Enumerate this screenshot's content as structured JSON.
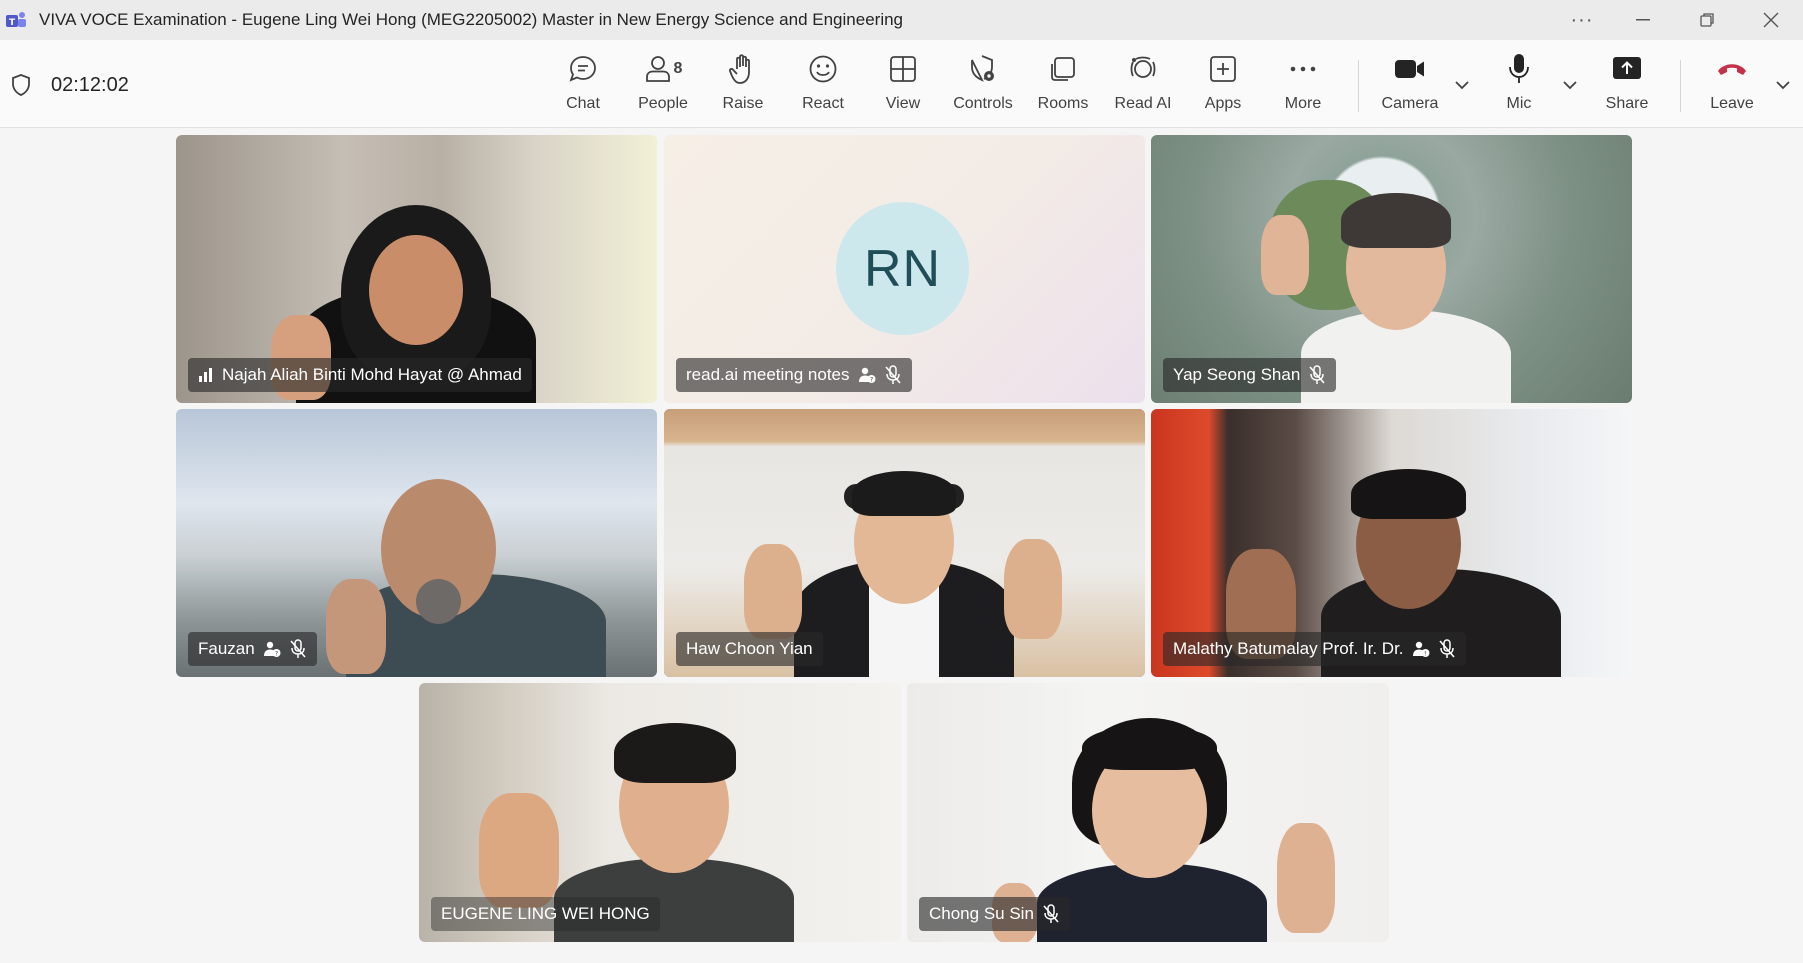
{
  "window": {
    "title": "VIVA VOCE Examination - Eugene Ling Wei Hong (MEG2205002) Master in New Energy Science and Engineering"
  },
  "meeting": {
    "timer": "02:12:02"
  },
  "toolbar": {
    "chat": "Chat",
    "people": "People",
    "people_count": "8",
    "raise": "Raise",
    "react": "React",
    "view": "View",
    "controls": "Controls",
    "rooms": "Rooms",
    "read_ai": "Read AI",
    "apps": "Apps",
    "more": "More",
    "camera": "Camera",
    "mic": "Mic",
    "share": "Share",
    "leave": "Leave"
  },
  "participants": [
    {
      "name": "Najah Aliah Binti Mohd Hayat @ Ahmad"
    },
    {
      "name": "read.ai meeting notes",
      "initials": "RN"
    },
    {
      "name": "Yap Seong Shan"
    },
    {
      "name": "Fauzan"
    },
    {
      "name": "Haw Choon Yian"
    },
    {
      "name": "Malathy Batumalay Prof. Ir. Dr."
    },
    {
      "name": "EUGENE LING WEI HONG"
    },
    {
      "name": "Chong Su Sin"
    }
  ],
  "colors": {
    "accent": "#5b5fc7",
    "leave": "#c4314b"
  }
}
